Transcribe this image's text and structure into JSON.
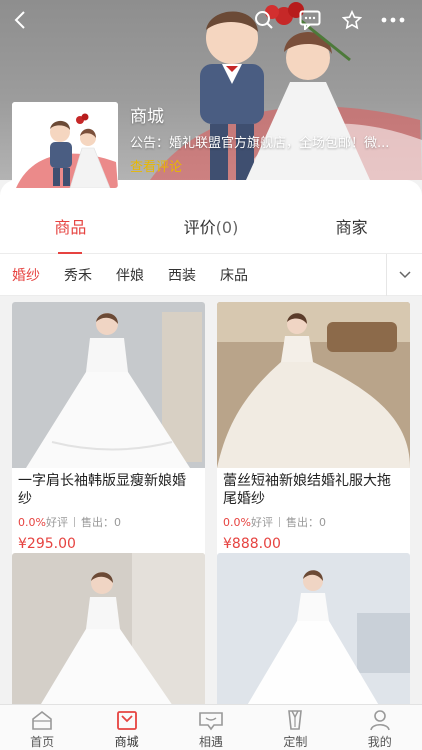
{
  "header": {
    "icons": [
      "back-icon",
      "search-icon",
      "message-icon",
      "star-icon",
      "more-icon"
    ]
  },
  "shop": {
    "name": "商城",
    "notice": "公告：婚礼联盟官方旗舰店，全场包邮！微...",
    "reviews_link": "查看评论"
  },
  "tabs": [
    {
      "label": "商品",
      "count": ""
    },
    {
      "label": "评价",
      "count": "(0)"
    },
    {
      "label": "商家",
      "count": ""
    }
  ],
  "categories": [
    "婚纱",
    "秀禾",
    "伴娘",
    "西装",
    "床品"
  ],
  "products": [
    {
      "title": "一字肩长袖韩版显瘦新娘婚纱",
      "rate": "0.0%",
      "rate_label": "好评",
      "sold_label": "售出：",
      "sold": "0",
      "price": "¥295.00"
    },
    {
      "title": " 蕾丝短袖新娘结婚礼服大拖尾婚纱",
      "rate": "0.0%",
      "rate_label": "好评",
      "sold_label": "售出：",
      "sold": "0",
      "price": "¥888.00"
    },
    {
      "title": "",
      "rate": "",
      "rate_label": "",
      "sold_label": "",
      "sold": "",
      "price": ""
    },
    {
      "title": "",
      "rate": "",
      "rate_label": "",
      "sold_label": "",
      "sold": "",
      "price": ""
    }
  ],
  "bottom_nav": [
    {
      "label": "首页",
      "icon": "home-icon"
    },
    {
      "label": "商城",
      "icon": "shop-bag-icon"
    },
    {
      "label": "相遇",
      "icon": "meet-icon"
    },
    {
      "label": "定制",
      "icon": "custom-suit-icon"
    },
    {
      "label": "我的",
      "icon": "profile-icon"
    }
  ],
  "colors": {
    "accent": "#e64340",
    "highlight": "#e8b800"
  }
}
